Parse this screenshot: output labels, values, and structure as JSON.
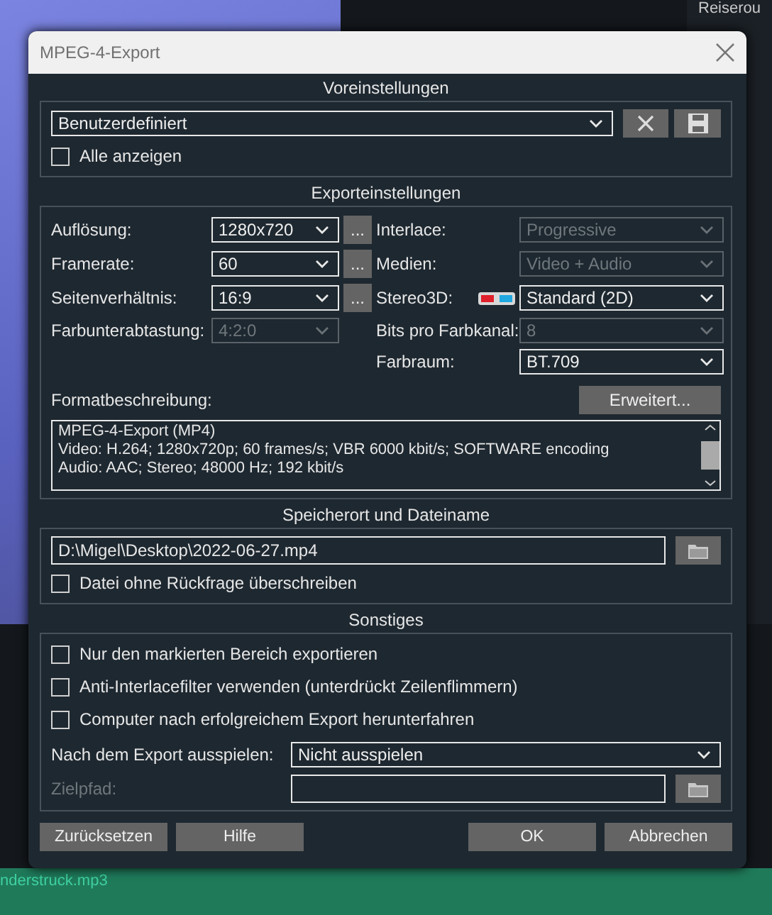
{
  "background": {
    "side_items": [
      "Reiserou"
    ],
    "audio_track": "nderstruck.mp3"
  },
  "window": {
    "title": "MPEG-4-Export"
  },
  "presets": {
    "title": "Voreinstellungen",
    "value": "Benutzerdefiniert",
    "show_all": {
      "label": "Alle anzeigen",
      "checked": false
    }
  },
  "export": {
    "title": "Exporteinstellungen",
    "left": [
      {
        "label": "Auflösung:",
        "value": "1280x720",
        "disabled": false,
        "more": "..."
      },
      {
        "label": "Framerate:",
        "value": "60",
        "disabled": false,
        "more": "..."
      },
      {
        "label": "Seitenverhältnis:",
        "value": "16:9",
        "disabled": false,
        "more": "..."
      },
      {
        "label": "Farbunterabtastung:",
        "value": "4:2:0",
        "disabled": true
      }
    ],
    "right": [
      {
        "label": "Interlace:",
        "value": "Progressive",
        "disabled": true,
        "kind": "plain"
      },
      {
        "label": "Medien:",
        "value": "Video + Audio",
        "disabled": true,
        "kind": "plain"
      },
      {
        "label": "Stereo3D:",
        "value": "Standard (2D)",
        "disabled": false,
        "kind": "anaglyph"
      },
      {
        "label": "Bits pro Farbkanal:",
        "value": "8",
        "disabled": true,
        "kind": "plain"
      },
      {
        "label": "Farbraum:",
        "value": "BT.709",
        "disabled": false,
        "kind": "plain"
      }
    ],
    "format_label": "Formatbeschreibung:",
    "advanced_button": "Erweitert...",
    "description": [
      "MPEG-4-Export (MP4)",
      "Video: H.264; 1280x720p; 60 frames/s; VBR 6000 kbit/s; SOFTWARE encoding",
      "Audio: AAC; Stereo; 48000 Hz; 192 kbit/s"
    ]
  },
  "location": {
    "title": "Speicherort und Dateiname",
    "path": "D:\\Migel\\Desktop\\2022-06-27.mp4",
    "overwrite": {
      "label": "Datei ohne Rückfrage überschreiben",
      "checked": false
    }
  },
  "misc": {
    "title": "Sonstiges",
    "options": [
      {
        "label": "Nur den markierten Bereich exportieren",
        "checked": false
      },
      {
        "label": "Anti-Interlacefilter verwenden (unterdrückt Zeilenflimmern)",
        "checked": false
      },
      {
        "label": "Computer nach erfolgreichem Export herunterfahren",
        "checked": false
      }
    ],
    "playback_label": "Nach dem Export ausspielen:",
    "playback_value": "Nicht ausspielen",
    "target_label": "Zielpfad:",
    "target_disabled": true
  },
  "buttons_left": [
    "Zurücksetzen",
    "Hilfe"
  ],
  "buttons_right": [
    "OK",
    "Abbrechen"
  ]
}
